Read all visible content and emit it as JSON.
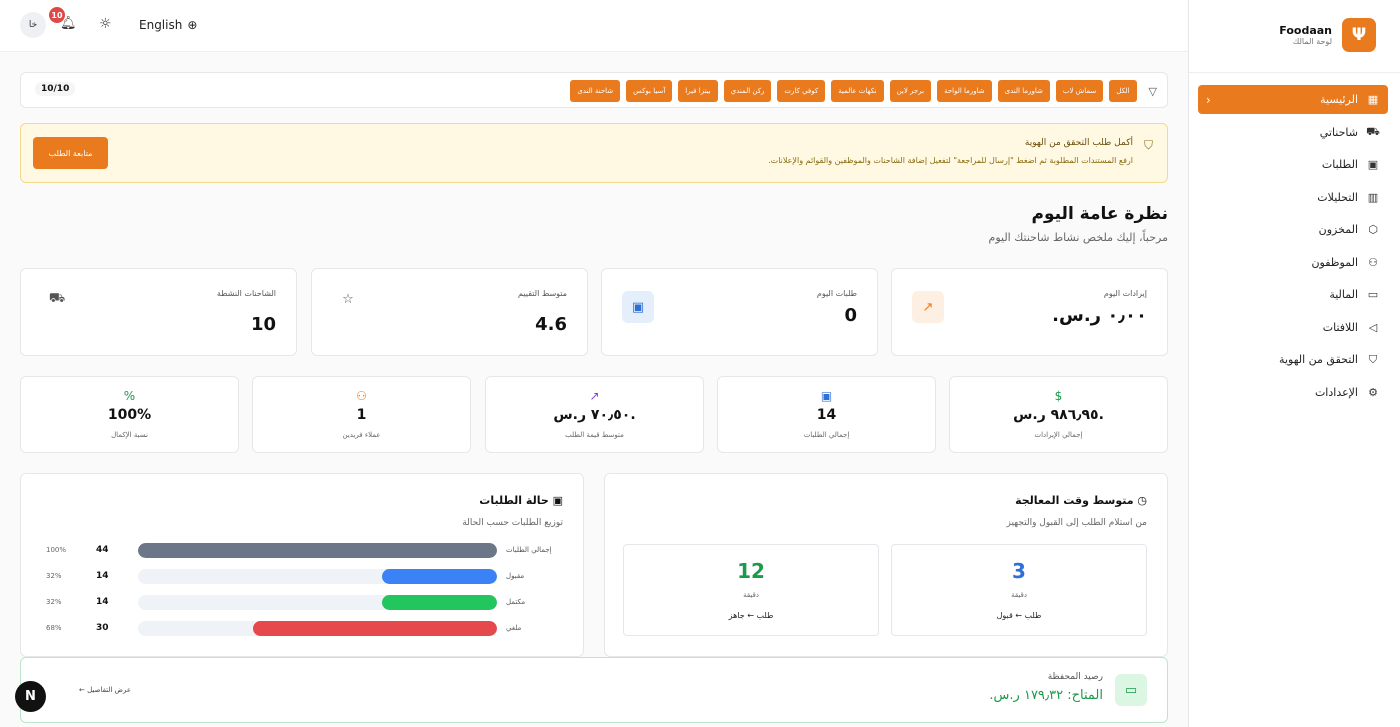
{
  "brand": {
    "name": "Foodaan",
    "subtitle": "لوحة المالك",
    "logo_icon": "fork-knife-icon"
  },
  "sidebar": {
    "items": [
      {
        "label": "الرئيسية",
        "icon": "grid-icon",
        "active": true
      },
      {
        "label": "شاحناتي",
        "icon": "truck-icon"
      },
      {
        "label": "الطلبات",
        "icon": "bag-icon"
      },
      {
        "label": "التحليلات",
        "icon": "chart-icon"
      },
      {
        "label": "المخزون",
        "icon": "box-icon"
      },
      {
        "label": "الموظفون",
        "icon": "users-icon"
      },
      {
        "label": "المالية",
        "icon": "wallet-icon"
      },
      {
        "label": "اللافتات",
        "icon": "megaphone-icon"
      },
      {
        "label": "التحقق من الهوية",
        "icon": "shield-icon"
      },
      {
        "label": "الإعدادات",
        "icon": "gear-icon"
      }
    ]
  },
  "topbar": {
    "avatar_initials": "خا",
    "notification_count": "10",
    "language": "English"
  },
  "filter": {
    "count": "10/10",
    "chips": [
      "الكل",
      "سماش لاب",
      "شاورما الندى",
      "شاورما الواحة",
      "برجر لاين",
      "نكهات عالمية",
      "كوفي كارت",
      "ركن المندي",
      "بيتزا فيرا",
      "آسيا بوكس",
      "شاحنة الندى"
    ]
  },
  "banner": {
    "title": "أكمل طلب التحقق من الهوية",
    "text": "ارفع المستندات المطلوبة ثم اضغط \"إرسال للمراجعة\" لتفعيل إضافة الشاحنات والموظفين والقوائم والإعلانات.",
    "button": "متابعة الطلب"
  },
  "overview": {
    "title": "نظرة عامة اليوم",
    "subtitle": "مرحباً، إليك ملخص نشاط شاحنتك اليوم"
  },
  "kpis": [
    {
      "label": "إيرادات اليوم",
      "value": "٠٫٠٠ ر.س.",
      "icon": "trend-icon"
    },
    {
      "label": "طلبات اليوم",
      "value": "0",
      "icon": "bag-icon"
    },
    {
      "label": "متوسط التقييم",
      "value": "4.6",
      "icon": "star-icon"
    },
    {
      "label": "الشاحنات النشطة",
      "value": "10",
      "icon": "truck-icon"
    }
  ],
  "stats": [
    {
      "label": "إجمالي الإيرادات",
      "value": "٩٨٦٫٩٥ ر.س.",
      "icon": "dollar-icon",
      "color": "#1a9a4a"
    },
    {
      "label": "إجمالي الطلبات",
      "value": "14",
      "icon": "bag-icon",
      "color": "#2f6fd6"
    },
    {
      "label": "متوسط قيمة الطلب",
      "value": "٧٠٫٥٠ ر.س.",
      "icon": "trend-icon",
      "color": "#8b3fd6"
    },
    {
      "label": "عملاء فريدين",
      "value": "1",
      "icon": "users-icon",
      "color": "#ea7a1e"
    },
    {
      "label": "نسبة الإكمال",
      "value": "100%",
      "icon": "percent-icon",
      "color": "#1a9a4a"
    }
  ],
  "processing": {
    "title": "متوسط وقت المعالجة",
    "subtitle": "من استلام الطلب إلى القبول والتجهيز",
    "boxes": [
      {
        "value": "3",
        "unit": "دقيقة",
        "label": "طلب ← قبول",
        "color": "#2f6fd6"
      },
      {
        "value": "12",
        "unit": "دقيقة",
        "label": "طلب ← جاهز",
        "color": "#1a9a4a"
      }
    ]
  },
  "order_status": {
    "title": "حالة الطلبات",
    "subtitle": "توزيع الطلبات حسب الحالة",
    "rows": [
      {
        "label": "إجمالي الطلبات",
        "count": "44",
        "pct": "100%",
        "fraction": 1.0,
        "color": "#6b7689"
      },
      {
        "label": "مقبول",
        "count": "14",
        "pct": "32%",
        "fraction": 0.32,
        "color": "#3b82f6"
      },
      {
        "label": "مكتمل",
        "count": "14",
        "pct": "32%",
        "fraction": 0.32,
        "color": "#22c55e"
      },
      {
        "label": "ملغي",
        "count": "30",
        "pct": "68%",
        "fraction": 0.68,
        "color": "#e5484d"
      }
    ]
  },
  "wallet": {
    "title": "رصيد المحفظة",
    "value": "المتاح: ١٧٩٫٣٢ ر.س.",
    "link": "عرض التفاصيل ←"
  },
  "colors": {
    "accent": "#ea7a1e"
  }
}
